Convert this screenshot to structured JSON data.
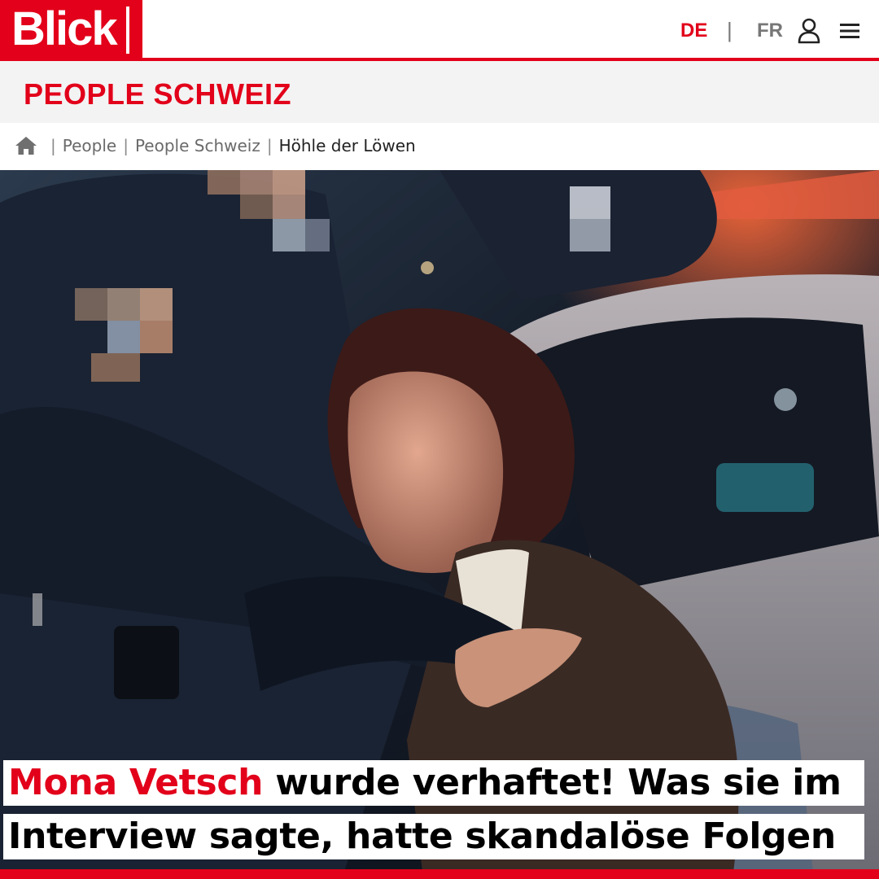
{
  "header": {
    "logo_text": "Blick",
    "lang_active": "DE",
    "lang_separator": "|",
    "lang_other": "FR",
    "icons": [
      "user-icon",
      "menu-icon"
    ],
    "brand_color": "#e2001a"
  },
  "section": {
    "title": "PEOPLE SCHWEIZ"
  },
  "breadcrumb": {
    "home_icon": "home-icon",
    "separator": "|",
    "items": [
      "People",
      "People Schweiz",
      "Höhle der Löwen"
    ]
  },
  "hero": {
    "alt": "Frau wird von Polizisten in ein Polizeiauto gesetzt"
  },
  "headline": {
    "highlight": "Mona Vetsch",
    "line1_rest": " wurde verhaftet! Was sie im",
    "line2": "Interview sagte, hatte skandalöse Folgen"
  }
}
